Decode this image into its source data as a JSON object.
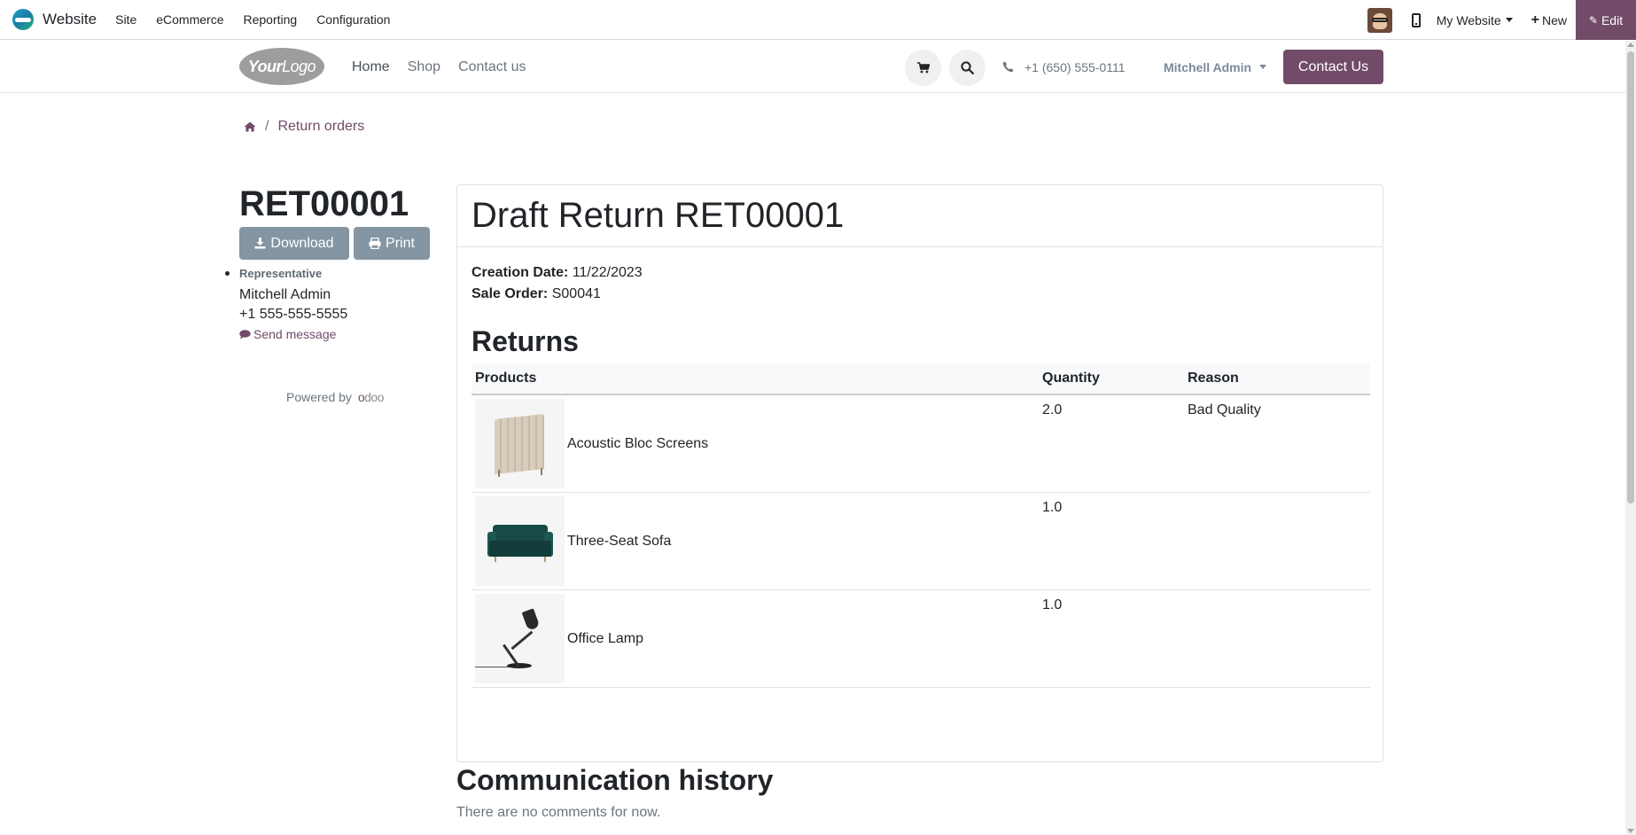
{
  "topbar": {
    "app_name": "Website",
    "menu": [
      "Site",
      "eCommerce",
      "Reporting",
      "Configuration"
    ],
    "website_selector": "My Website",
    "new_label": "New",
    "edit_label": "Edit",
    "edit_color": "#714b67"
  },
  "site_header": {
    "logo_text_bold": "Your",
    "logo_text": "Logo",
    "nav": [
      "Home",
      "Shop",
      "Contact us"
    ],
    "phone": "+1 (650) 555-0111",
    "user": "Mitchell Admin",
    "cta": "Contact Us",
    "icons": [
      "cart-icon",
      "search-icon",
      "phone-icon"
    ]
  },
  "breadcrumb": {
    "current": "Return orders"
  },
  "sidebar": {
    "reference": "RET00001",
    "download_label": "Download",
    "print_label": "Print",
    "representative_title": "Representative",
    "representative_name": "Mitchell Admin",
    "representative_phone": "+1 555-555-5555",
    "send_message": "Send message",
    "powered_by": "Powered by",
    "powered_brand": "odoo"
  },
  "card": {
    "title": "Draft Return RET00001",
    "creation_date_label": "Creation Date:",
    "creation_date": "11/22/2023",
    "sale_order_label": "Sale Order:",
    "sale_order": "S00041",
    "returns_title": "Returns",
    "columns": [
      "Products",
      "Quantity",
      "Reason"
    ],
    "rows": [
      {
        "product": "Acoustic Bloc Screens",
        "quantity": "2.0",
        "reason": "Bad Quality"
      },
      {
        "product": "Three-Seat Sofa",
        "quantity": "1.0",
        "reason": ""
      },
      {
        "product": "Office Lamp",
        "quantity": "1.0",
        "reason": ""
      }
    ]
  },
  "communication": {
    "title": "Communication history",
    "empty": "There are no comments for now."
  },
  "colors": {
    "accent": "#714b67",
    "button_grey": "#8595a2"
  }
}
